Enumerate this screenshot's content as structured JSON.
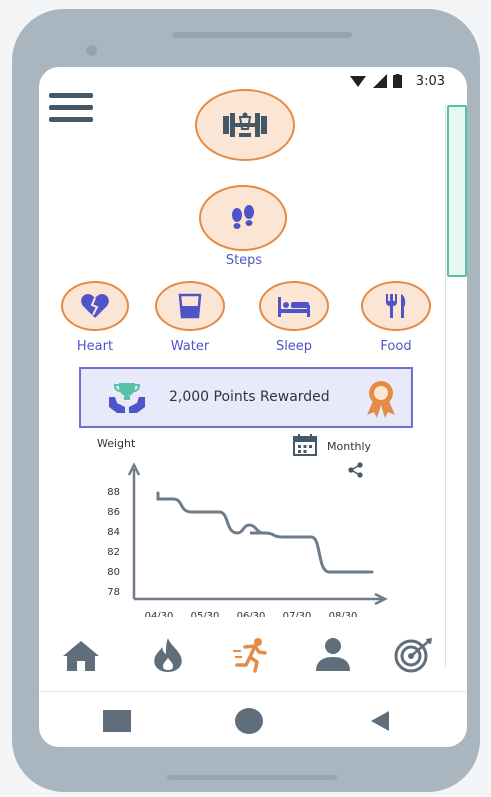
{
  "status_bar": {
    "time": "3:03"
  },
  "top_icons": {
    "steps_label": "Steps"
  },
  "categories": [
    {
      "label": "Heart",
      "icon": "broken-heart-icon"
    },
    {
      "label": "Water",
      "icon": "water-glass-icon"
    },
    {
      "label": "Sleep",
      "icon": "bed-icon"
    },
    {
      "label": "Food",
      "icon": "fork-knife-icon"
    }
  ],
  "reward": {
    "text": "2,000 Points Rewarded"
  },
  "weight_chart": {
    "period_label": "Monthly",
    "colors": {
      "line": "#6d7c88",
      "axis": "#6d7c88"
    }
  },
  "chart_data": {
    "type": "line",
    "title": "",
    "ylabel": "Weight",
    "xlabel": "",
    "x": [
      "04/30",
      "05/30",
      "06/30",
      "07/30",
      "08/30"
    ],
    "yticks": [
      88,
      86,
      84,
      82,
      80,
      78
    ],
    "ylim": [
      78,
      88
    ],
    "series": [
      {
        "values": [
          87.2,
          85.9,
          83.8,
          83.4,
          79.9
        ]
      }
    ]
  },
  "bottom_nav": [
    {
      "icon": "home-icon",
      "active": false
    },
    {
      "icon": "flame-icon",
      "active": false
    },
    {
      "icon": "running-icon",
      "active": true
    },
    {
      "icon": "user-icon",
      "active": false
    },
    {
      "icon": "target-icon",
      "active": false
    }
  ],
  "colors": {
    "accent": "#e48b45",
    "primary": "#4f55c8",
    "teal": "#57c2a8"
  }
}
